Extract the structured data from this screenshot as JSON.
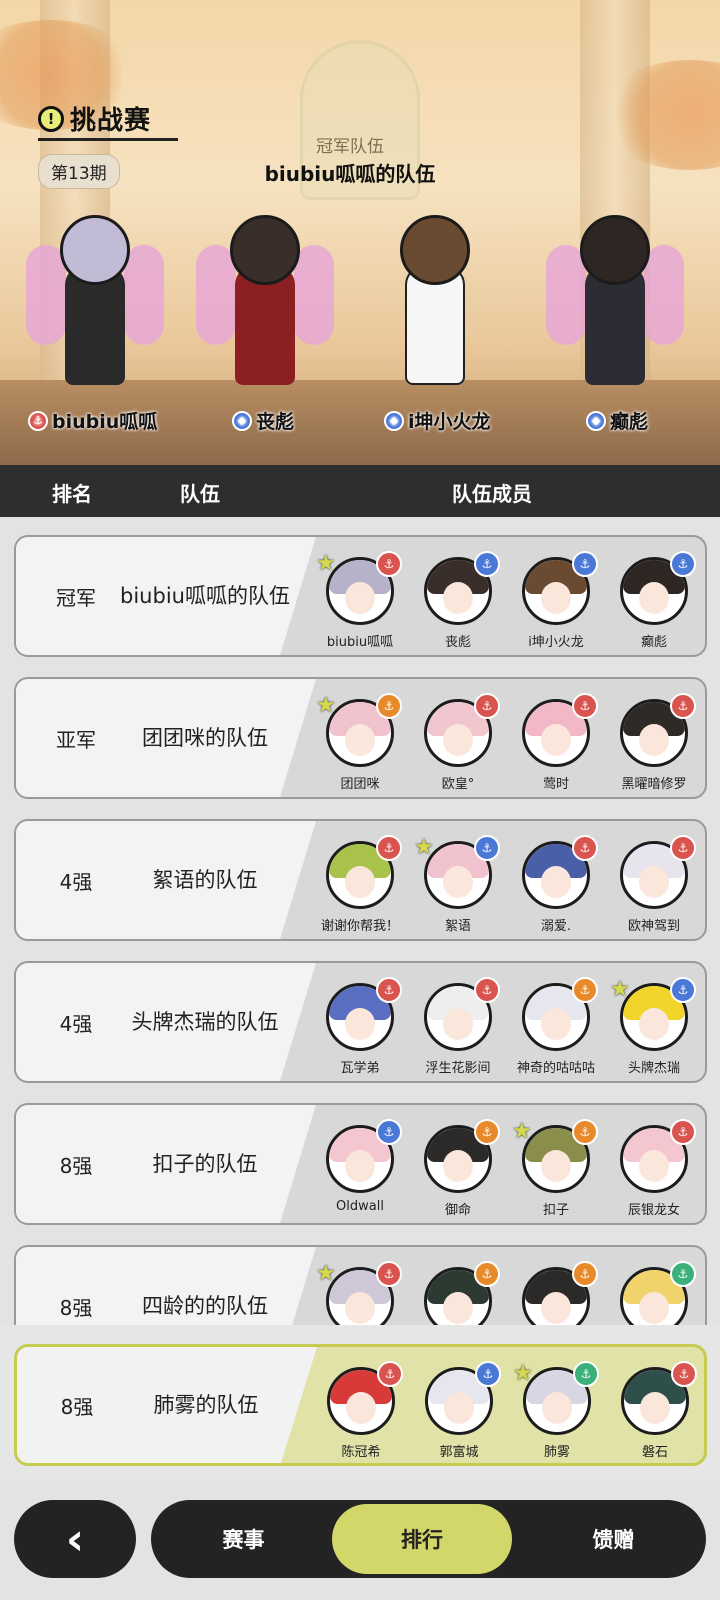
{
  "banner": {
    "title": "挑战赛",
    "title_icon": "!",
    "period": "第13期",
    "champion_label": "冠军队伍",
    "champion_team": "biubiu呱呱的队伍",
    "heroes": [
      {
        "name": "biubiu呱呱",
        "role_color": "#d9534f",
        "role_icon": "anchor-icon"
      },
      {
        "name": "丧彪",
        "role_color": "#4a78d6",
        "role_icon": "shield-icon"
      },
      {
        "name": "i坤小火龙",
        "role_color": "#4a78d6",
        "role_icon": "shield-icon"
      },
      {
        "name": "癫彪",
        "role_color": "#4a78d6",
        "role_icon": "shield-icon"
      }
    ]
  },
  "table": {
    "col_rank": "排名",
    "col_team": "队伍",
    "col_members": "队伍成员"
  },
  "rows": [
    {
      "rank": "冠军",
      "team": "biubiu呱呱的队伍",
      "members": [
        {
          "name": "biubiu呱呱",
          "badge": "#d9534f",
          "star": true,
          "hair": "#b7b2c9"
        },
        {
          "name": "丧彪",
          "badge": "#4a78d6",
          "star": false,
          "hair": "#3a2e2a"
        },
        {
          "name": "i坤小火龙",
          "badge": "#4a78d6",
          "star": false,
          "hair": "#6b4a32"
        },
        {
          "name": "癫彪",
          "badge": "#4a78d6",
          "star": false,
          "hair": "#2e2622"
        }
      ]
    },
    {
      "rank": "亚军",
      "team": "团团咪的队伍",
      "members": [
        {
          "name": "团团咪",
          "badge": "#e88a2a",
          "star": true,
          "hair": "#f0c3cf"
        },
        {
          "name": "欧皇°",
          "badge": "#d9534f",
          "star": false,
          "hair": "#f1c6cf"
        },
        {
          "name": "莺时",
          "badge": "#d9534f",
          "star": false,
          "hair": "#f3b8c8"
        },
        {
          "name": "黑曜暗修罗",
          "badge": "#d9534f",
          "star": false,
          "hair": "#2f2a26"
        }
      ]
    },
    {
      "rank": "4强",
      "team": "絮语的队伍",
      "members": [
        {
          "name": "谢谢你帮我！",
          "badge": "#d9534f",
          "star": false,
          "hair": "#a9c24a"
        },
        {
          "name": "絮语",
          "badge": "#4a78d6",
          "star": true,
          "hair": "#f0c3cf"
        },
        {
          "name": "溺爱.",
          "badge": "#d9534f",
          "star": false,
          "hair": "#4b5ea8"
        },
        {
          "name": "欧神驾到",
          "badge": "#d9534f",
          "star": false,
          "hair": "#e8e4ee"
        }
      ]
    },
    {
      "rank": "4强",
      "team": "头牌杰瑞的队伍",
      "members": [
        {
          "name": "瓦学弟",
          "badge": "#d9534f",
          "star": false,
          "hair": "#5b6fc2"
        },
        {
          "name": "浮生花影间",
          "badge": "#d9534f",
          "star": false,
          "hair": "#eeeeee"
        },
        {
          "name": "神奇的咕咕咕",
          "badge": "#e88a2a",
          "star": false,
          "hair": "#e6e6ee"
        },
        {
          "name": "头牌杰瑞",
          "badge": "#4a78d6",
          "star": true,
          "hair": "#f2d52a"
        }
      ]
    },
    {
      "rank": "8强",
      "team": "扣子的队伍",
      "members": [
        {
          "name": "Oldwall",
          "badge": "#4a78d6",
          "star": false,
          "hair": "#f3c6d0"
        },
        {
          "name": "御命",
          "badge": "#e88a2a",
          "star": false,
          "hair": "#2b2a28"
        },
        {
          "name": "扣子",
          "badge": "#e88a2a",
          "star": true,
          "hair": "#8a8e4a"
        },
        {
          "name": "辰银龙女",
          "badge": "#d9534f",
          "star": false,
          "hair": "#f3c6d0"
        }
      ]
    },
    {
      "rank": "8强",
      "team": "四龄的的队伍",
      "members": [
        {
          "name": "",
          "badge": "#d9534f",
          "star": true,
          "hair": "#cfc8d8"
        },
        {
          "name": "",
          "badge": "#e88a2a",
          "star": false,
          "hair": "#2c3a32"
        },
        {
          "name": "",
          "badge": "#e88a2a",
          "star": false,
          "hair": "#2b2a28"
        },
        {
          "name": "",
          "badge": "#3bb07a",
          "star": false,
          "hair": "#f0d36a"
        }
      ]
    }
  ],
  "pinned_row": {
    "rank": "8强",
    "team": "肺雾的队伍",
    "members": [
      {
        "name": "陈冠希",
        "badge": "#d9534f",
        "star": false,
        "hair": "#d83a3a"
      },
      {
        "name": "郭富城",
        "badge": "#4a78d6",
        "star": false,
        "hair": "#e6e6ee"
      },
      {
        "name": "肺雾",
        "badge": "#3bb07a",
        "star": true,
        "hair": "#d8d6e2"
      },
      {
        "name": "磐石",
        "badge": "#d9534f",
        "star": false,
        "hair": "#2e4f4a"
      }
    ]
  },
  "nav": {
    "back_icon": "chevron-left-icon",
    "back_glyph": "‹",
    "tabs": [
      {
        "label": "赛事",
        "active": false
      },
      {
        "label": "排行",
        "active": true
      },
      {
        "label": "馈赠",
        "active": false
      }
    ]
  },
  "colors": {
    "accent": "#d3d76a",
    "dark": "#232323",
    "header": "#2e2e2e"
  }
}
